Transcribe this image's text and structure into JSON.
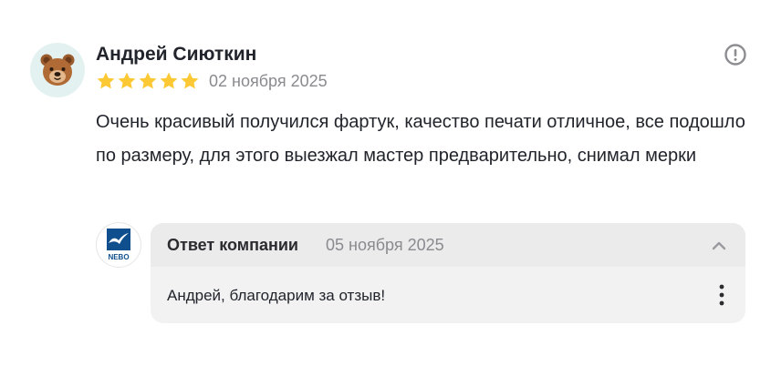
{
  "review": {
    "author_name": "Андрей Сиюткин",
    "avatar_icon": "bear-face-icon",
    "rating": 5,
    "rating_max": 5,
    "date": "02 ноября 2025",
    "text": "Очень красивый получился фартук, качество печати отличное, все подошло по размеру, для этого выезжал мастер предварительно, снимал мерки",
    "report_icon": "exclamation-circle-icon"
  },
  "reply": {
    "company_logo_text": "NEBO",
    "title": "Ответ компании",
    "date": "05 ноября 2025",
    "text": "Андрей, благодарим за отзыв!",
    "collapse_icon": "chevron-up-icon",
    "menu_icon": "more-vertical-icon"
  },
  "colors": {
    "star": "#fcc934",
    "muted_text": "#8a8a8f",
    "avatar_bg": "#e3f2f1",
    "logo_blue": "#0f4f8e",
    "reply_bg": "#f2f2f2"
  }
}
